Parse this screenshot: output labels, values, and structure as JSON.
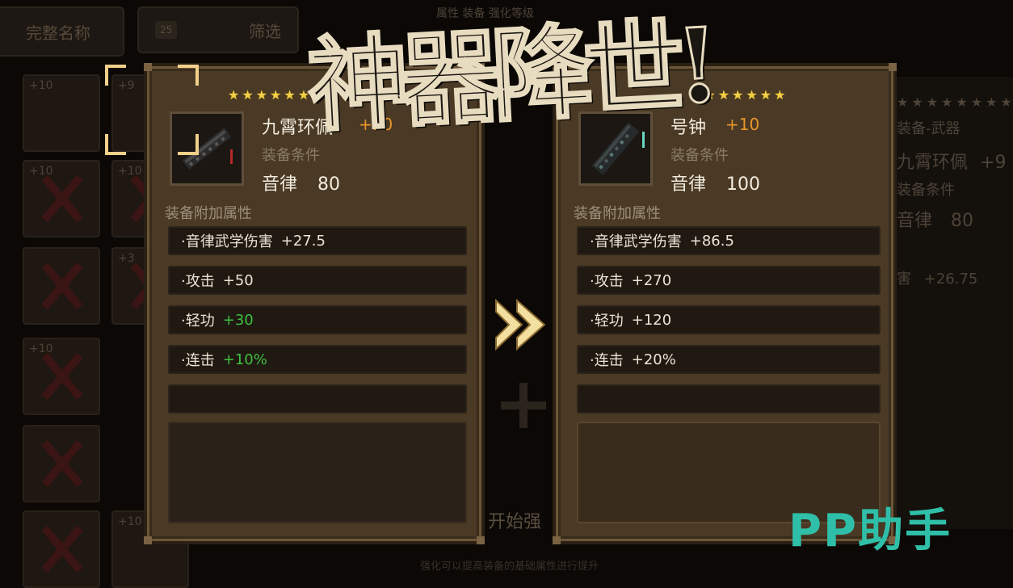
{
  "background": {
    "top_left_button_label": "完整名称",
    "filter_button_label": "筛选",
    "filter_icon_label": "25",
    "top_hint_text": "属性  装备  强化等级",
    "bottom_button_label": "开始强",
    "bottom_hint_text": "强化可以提高装备的基础属性进行提升",
    "slot_levels": [
      "+10",
      "+9",
      "+10",
      "+10",
      "+3",
      "+10",
      "+10"
    ],
    "right_panel": {
      "category": "装备-武器",
      "item_name": "九霄环佩",
      "item_plus": "+9",
      "req_label": "装备条件",
      "req_stat": "音律",
      "req_value": "80",
      "stat_line_label": "害",
      "stat_line_value": "+26.75"
    }
  },
  "title_text": "神器降世!",
  "left_card": {
    "stars": 10,
    "name": "九霄环佩",
    "plus": "+10",
    "req_label": "装备条件",
    "req_stat": "音律",
    "req_value": "80",
    "section_label": "装备附加属性",
    "attributes": [
      {
        "label": "·音律武学伤害",
        "value": "+27.5",
        "color": "#ece4d4"
      },
      {
        "label": "·攻击",
        "value": "+50",
        "color": "#ece4d4"
      },
      {
        "label": "·轻功",
        "value": "+30",
        "color": "#3fbf3f"
      },
      {
        "label": "·连击",
        "value": "+10%",
        "color": "#3fbf3f"
      }
    ]
  },
  "right_card": {
    "stars": 7,
    "name": "号钟",
    "plus": "+10",
    "req_label": "装备条件",
    "req_stat": "音律",
    "req_value": "100",
    "section_label": "装备附加属性",
    "attributes": [
      {
        "label": "·音律武学伤害",
        "value": "+86.5",
        "color": "#ece4d4"
      },
      {
        "label": "·攻击",
        "value": "+270",
        "color": "#ece4d4"
      },
      {
        "label": "·轻功",
        "value": "+120",
        "color": "#ece4d4"
      },
      {
        "label": "·连击",
        "value": "+20%",
        "color": "#ece4d4"
      }
    ]
  },
  "watermark_text": "PP助手",
  "colors": {
    "star": "#f2cf46",
    "plus_value": "#e8962a",
    "green_value": "#3fbf3f",
    "watermark": "#2fbfa8",
    "card_bg": "#4a3924"
  }
}
